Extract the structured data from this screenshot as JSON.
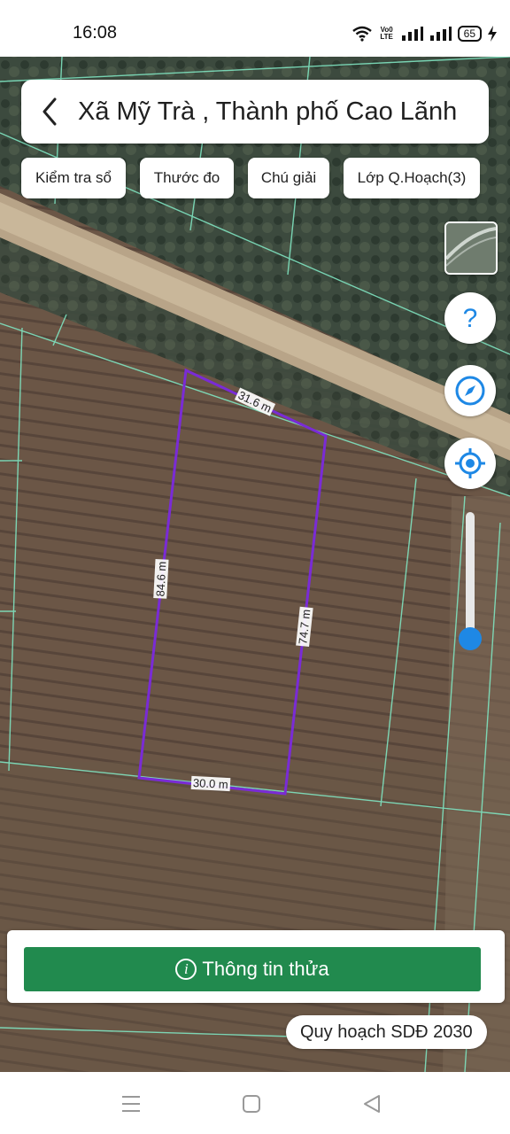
{
  "status_bar": {
    "time": "16:08",
    "volte": "Vo0\nLTE",
    "battery": "65"
  },
  "header": {
    "location_title": "Xã Mỹ Trà , Thành phố Cao Lãnh"
  },
  "chips": [
    {
      "label": "Kiểm tra sổ"
    },
    {
      "label": "Thước đo"
    },
    {
      "label": "Chú giải"
    },
    {
      "label": "Lớp Q.Hoạch(3)"
    }
  ],
  "controls": {
    "help": "help-icon",
    "compass": "compass-icon",
    "locate": "locate-icon",
    "zoom_level": 0.15
  },
  "parcel": {
    "edge_top": "31.6 m",
    "edge_left": "84.6 m",
    "edge_right": "74.7 m",
    "edge_bottom": "30.0 m"
  },
  "panel": {
    "button_label": "Thông tin thửa"
  },
  "plan_tag": "Quy hoạch SDĐ 2030",
  "colors": {
    "accent_green": "#218a4e",
    "parcel_outline": "#7a2bd6",
    "slider_blue": "#1e88e5",
    "parcel_lines": "#7fe3c0"
  }
}
